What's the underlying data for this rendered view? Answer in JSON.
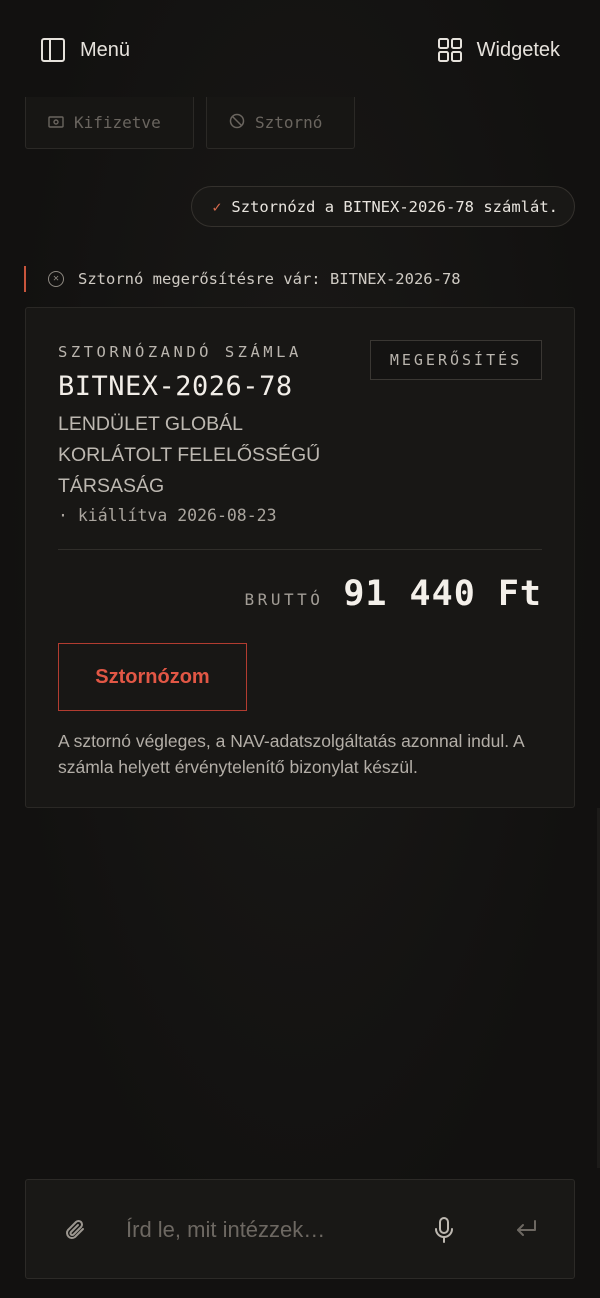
{
  "header": {
    "menu_label": "Menü",
    "widgets_label": "Widgetek"
  },
  "previous_actions": [
    {
      "label": "Kifizetve",
      "icon": "cash-icon"
    },
    {
      "label": "Sztornó",
      "icon": "ban-icon"
    }
  ],
  "user_message": {
    "text": "Sztornózd a BITNEX-2026-78 számlát."
  },
  "status": {
    "text": "Sztornó megerősítésre vár: BITNEX-2026-78"
  },
  "card": {
    "eyebrow": "SZTORNÓZANDÓ SZÁMLA",
    "badge": "MEGERŐSÍTÉS",
    "invoice_number": "BITNEX-2026-78",
    "company_lines": [
      "LENDÜLET GLOBÁL",
      "KORLÁTOLT FELELŐSSÉGŰ",
      "TÁRSASÁG"
    ],
    "issued": "· kiállítva 2026-08-23",
    "total_label": "BRUTTÓ",
    "total_amount": "91 440 Ft",
    "cancel_button": "Sztornózom",
    "note": "A sztornó végleges, a NAV-adatszolgáltatás azonnal indul. A számla helyett érvénytelenítő bizonylat készül."
  },
  "composer": {
    "placeholder": "Írd le, mit intézzek…",
    "value": ""
  },
  "colors": {
    "accent": "#c8553c",
    "danger": "#e25745",
    "background": "#121110"
  }
}
